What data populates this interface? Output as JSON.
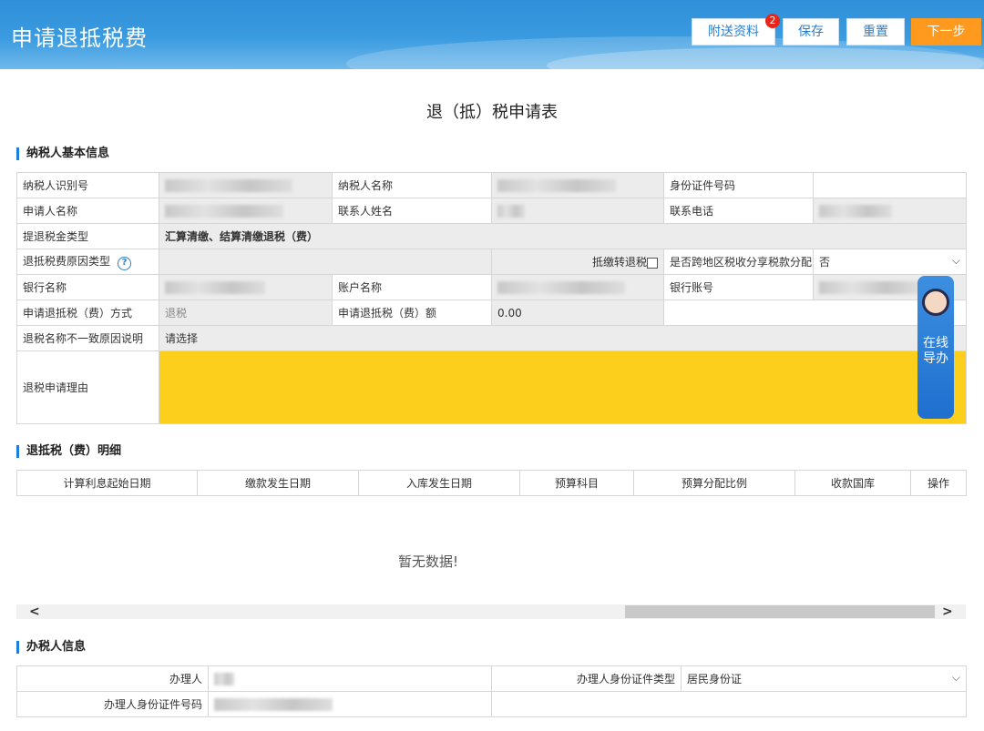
{
  "header": {
    "title": "申请退抵税费",
    "buttons": {
      "attach": "附送资料",
      "attach_badge": "2",
      "save": "保存",
      "reset": "重置",
      "next": "下一步"
    }
  },
  "form_title": "退（抵）税申请表",
  "basic": {
    "section_title": "纳税人基本信息",
    "labels": {
      "taxpayer_id": "纳税人识别号",
      "taxpayer_name": "纳税人名称",
      "id_number": "身份证件号码",
      "applicant_name": "申请人名称",
      "contact_name": "联系人姓名",
      "contact_phone": "联系电话",
      "refund_type": "提退税金类型",
      "refund_type_value": "汇算清缴、结算清缴退税（费）",
      "reason_type": "退抵税费原因类型",
      "transfer_refund": "抵缴转退税",
      "cross_region": "是否跨地区税收分享税款分配",
      "cross_region_value": "否",
      "bank_name": "银行名称",
      "account_name": "账户名称",
      "bank_account": "银行账号",
      "method": "申请退抵税（费）方式",
      "method_value": "退税",
      "amount": "申请退抵税（费）额",
      "amount_value": "0.00",
      "mismatch_reason": "退税名称不一致原因说明",
      "mismatch_placeholder": "请选择",
      "apply_reason": "退税申请理由"
    }
  },
  "detail": {
    "section_title": "退抵税（费）明细",
    "columns": [
      "计算利息起始日期",
      "缴款发生日期",
      "入库发生日期",
      "预算科目",
      "预算分配比例",
      "收款国库",
      "操作"
    ],
    "empty_text": "暂无数据!"
  },
  "agent": {
    "section_title": "办税人信息",
    "labels": {
      "agent": "办理人",
      "id_type": "办理人身份证件类型",
      "id_type_value": "居民身份证",
      "id_number": "办理人身份证件号码"
    }
  },
  "assistant": {
    "label": "在线导办"
  },
  "colors": {
    "accent": "#1e7fd6",
    "primary_button": "#ff9a1f",
    "highlight": "#fccf1c"
  }
}
